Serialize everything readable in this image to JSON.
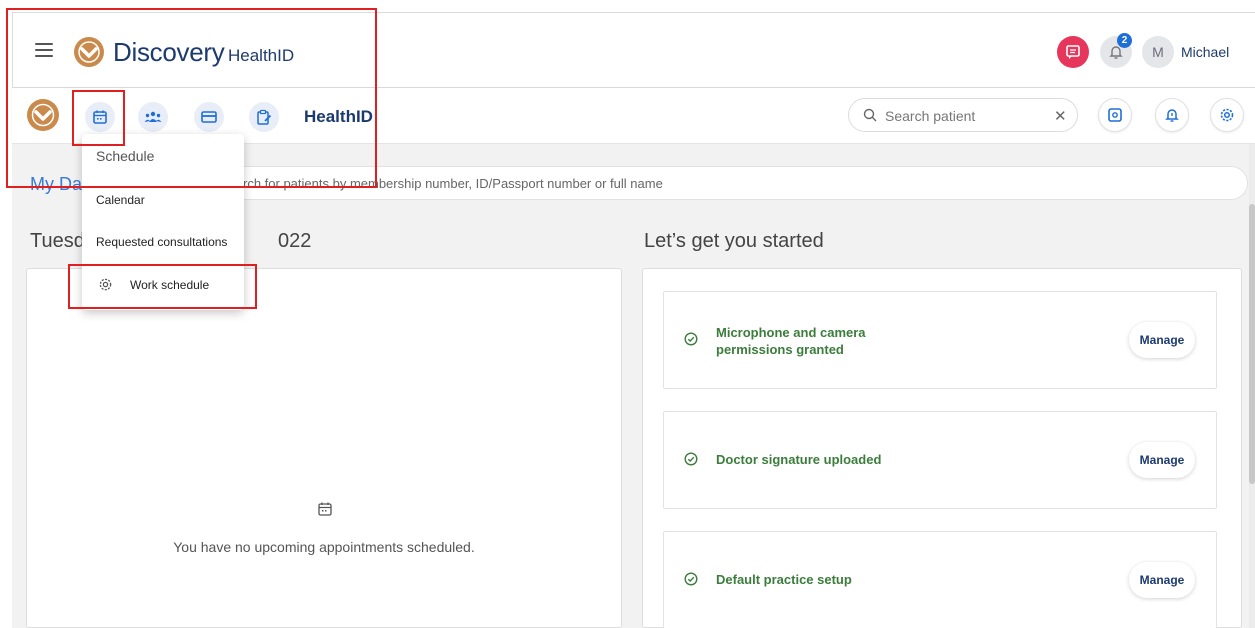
{
  "header": {
    "brand_name": "Discovery",
    "brand_sub": "HealthID",
    "notification_count": "2",
    "avatar_initial": "M",
    "username": "Michael"
  },
  "toolbar": {
    "title": "HealthID",
    "search_placeholder": "Search patient",
    "clear_label": "✕"
  },
  "dropdown": {
    "header": "Schedule",
    "items": [
      "Calendar",
      "Requested consultations",
      "Work schedule"
    ]
  },
  "main": {
    "dashboard_title": "My Da",
    "patient_search_placeholder": "rch for patients by membership number, ID/Passport number or full name",
    "date_heading_start": "Tuesd",
    "date_heading_end": "022",
    "started_heading": "Let’s get you started",
    "empty_message": "You have no upcoming appointments scheduled.",
    "tasks": [
      {
        "label": "Microphone and camera permissions granted",
        "button": "Manage"
      },
      {
        "label": "Doctor signature uploaded",
        "button": "Manage"
      },
      {
        "label": "Default practice setup",
        "button": "Manage"
      }
    ]
  },
  "colors": {
    "brand_navy": "#1d3a6e",
    "accent_blue": "#3a7bd5",
    "chat_pink": "#e6365c",
    "success_green": "#3b7d3b",
    "highlight_red": "#e02020",
    "logo_orange": "#c98a4b"
  },
  "icons": [
    "menu-icon",
    "discovery-logo-icon",
    "chat-icon",
    "bell-icon",
    "calendar-icon",
    "group-icon",
    "card-icon",
    "clipboard-icon",
    "search-icon",
    "close-icon",
    "settings-icon",
    "check-circle-icon"
  ]
}
